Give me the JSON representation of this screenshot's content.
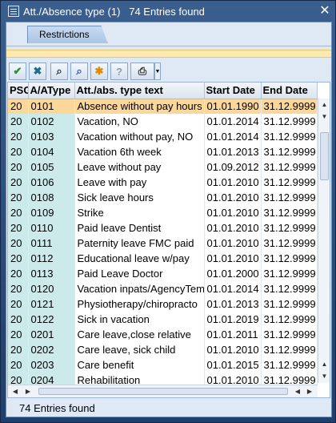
{
  "window": {
    "title": "Att./Absence type (1)   74 Entries found",
    "close_glyph": "✕"
  },
  "tabs": [
    {
      "label": "Restrictions"
    }
  ],
  "toolbar": {
    "buttons": [
      {
        "icon": "checkmark-icon",
        "glyph": "✔",
        "color": "#2e8b2e"
      },
      {
        "icon": "cancel-icon",
        "glyph": "✖",
        "color": "#1c6e8c"
      },
      {
        "icon": "find-icon",
        "glyph": "⌕",
        "color": "#333333"
      },
      {
        "icon": "find-next-icon",
        "glyph": "⌕",
        "color": "#2a5a9a"
      },
      {
        "icon": "new-entry-icon",
        "glyph": "✱",
        "color": "#e08a00"
      },
      {
        "icon": "info-icon",
        "glyph": "?",
        "color": "#9a9a9a"
      },
      {
        "icon": "print-icon",
        "glyph": "⎙",
        "color": "#333333"
      }
    ]
  },
  "table": {
    "columns": [
      "PSG",
      "A/AType",
      "Att./abs. type text",
      "Start Date",
      "End Date"
    ],
    "rows": [
      [
        "20",
        "0101",
        "Absence without pay hours",
        "01.01.1990",
        "31.12.9999"
      ],
      [
        "20",
        "0102",
        "Vacation, NO",
        "01.01.2014",
        "31.12.9999"
      ],
      [
        "20",
        "0103",
        "Vacation without pay, NO",
        "01.01.2014",
        "31.12.9999"
      ],
      [
        "20",
        "0104",
        "Vacation 6th week",
        "01.01.2013",
        "31.12.9999"
      ],
      [
        "20",
        "0105",
        "Leave without pay",
        "01.09.2012",
        "31.12.9999"
      ],
      [
        "20",
        "0106",
        "Leave with pay",
        "01.01.2010",
        "31.12.9999"
      ],
      [
        "20",
        "0108",
        "Sick leave hours",
        "01.01.2010",
        "31.12.9999"
      ],
      [
        "20",
        "0109",
        "Strike",
        "01.01.2010",
        "31.12.9999"
      ],
      [
        "20",
        "0110",
        "Paid leave Dentist",
        "01.01.2010",
        "31.12.9999"
      ],
      [
        "20",
        "0111",
        "Paternity leave FMC paid",
        "01.01.2010",
        "31.12.9999"
      ],
      [
        "20",
        "0112",
        "Educational leave w/pay",
        "01.01.2010",
        "31.12.9999"
      ],
      [
        "20",
        "0113",
        "Paid Leave Doctor",
        "01.01.2000",
        "31.12.9999"
      ],
      [
        "20",
        "0120",
        "Vacation inpats/AgencyTem",
        "01.01.2014",
        "31.12.9999"
      ],
      [
        "20",
        "0121",
        "Physiotherapy/chiropracto",
        "01.01.2013",
        "31.12.9999"
      ],
      [
        "20",
        "0122",
        "Sick in vacation",
        "01.01.2019",
        "31.12.9999"
      ],
      [
        "20",
        "0201",
        "Care leave,close relative",
        "01.01.2011",
        "31.12.9999"
      ],
      [
        "20",
        "0202",
        "Care leave, sick child",
        "01.01.2010",
        "31.12.9999"
      ],
      [
        "20",
        "0203",
        "Care benefit",
        "01.01.2015",
        "31.12.9999"
      ],
      [
        "20",
        "0204",
        "Rehabilitation",
        "01.01.2010",
        "31.12.9999"
      ]
    ],
    "selected_row": 0
  },
  "status": {
    "text": "74 Entries found"
  }
}
